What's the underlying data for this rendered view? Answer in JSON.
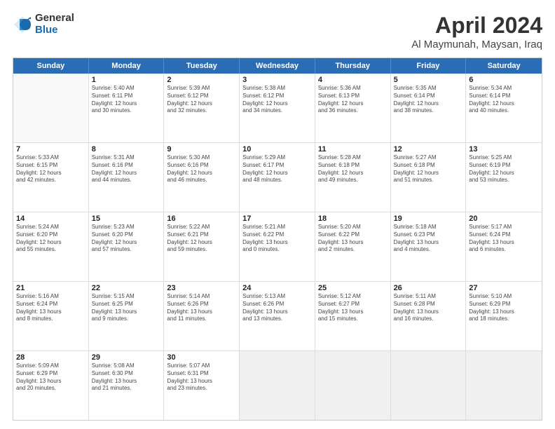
{
  "logo": {
    "general": "General",
    "blue": "Blue"
  },
  "title": {
    "month": "April 2024",
    "location": "Al Maymunah, Maysan, Iraq"
  },
  "days": [
    "Sunday",
    "Monday",
    "Tuesday",
    "Wednesday",
    "Thursday",
    "Friday",
    "Saturday"
  ],
  "weeks": [
    [
      {
        "day": "",
        "data": ""
      },
      {
        "day": "1",
        "data": "Sunrise: 5:40 AM\nSunset: 6:11 PM\nDaylight: 12 hours\nand 30 minutes."
      },
      {
        "day": "2",
        "data": "Sunrise: 5:39 AM\nSunset: 6:12 PM\nDaylight: 12 hours\nand 32 minutes."
      },
      {
        "day": "3",
        "data": "Sunrise: 5:38 AM\nSunset: 6:12 PM\nDaylight: 12 hours\nand 34 minutes."
      },
      {
        "day": "4",
        "data": "Sunrise: 5:36 AM\nSunset: 6:13 PM\nDaylight: 12 hours\nand 36 minutes."
      },
      {
        "day": "5",
        "data": "Sunrise: 5:35 AM\nSunset: 6:14 PM\nDaylight: 12 hours\nand 38 minutes."
      },
      {
        "day": "6",
        "data": "Sunrise: 5:34 AM\nSunset: 6:14 PM\nDaylight: 12 hours\nand 40 minutes."
      }
    ],
    [
      {
        "day": "7",
        "data": "Sunrise: 5:33 AM\nSunset: 6:15 PM\nDaylight: 12 hours\nand 42 minutes."
      },
      {
        "day": "8",
        "data": "Sunrise: 5:31 AM\nSunset: 6:16 PM\nDaylight: 12 hours\nand 44 minutes."
      },
      {
        "day": "9",
        "data": "Sunrise: 5:30 AM\nSunset: 6:16 PM\nDaylight: 12 hours\nand 46 minutes."
      },
      {
        "day": "10",
        "data": "Sunrise: 5:29 AM\nSunset: 6:17 PM\nDaylight: 12 hours\nand 48 minutes."
      },
      {
        "day": "11",
        "data": "Sunrise: 5:28 AM\nSunset: 6:18 PM\nDaylight: 12 hours\nand 49 minutes."
      },
      {
        "day": "12",
        "data": "Sunrise: 5:27 AM\nSunset: 6:18 PM\nDaylight: 12 hours\nand 51 minutes."
      },
      {
        "day": "13",
        "data": "Sunrise: 5:25 AM\nSunset: 6:19 PM\nDaylight: 12 hours\nand 53 minutes."
      }
    ],
    [
      {
        "day": "14",
        "data": "Sunrise: 5:24 AM\nSunset: 6:20 PM\nDaylight: 12 hours\nand 55 minutes."
      },
      {
        "day": "15",
        "data": "Sunrise: 5:23 AM\nSunset: 6:20 PM\nDaylight: 12 hours\nand 57 minutes."
      },
      {
        "day": "16",
        "data": "Sunrise: 5:22 AM\nSunset: 6:21 PM\nDaylight: 12 hours\nand 59 minutes."
      },
      {
        "day": "17",
        "data": "Sunrise: 5:21 AM\nSunset: 6:22 PM\nDaylight: 13 hours\nand 0 minutes."
      },
      {
        "day": "18",
        "data": "Sunrise: 5:20 AM\nSunset: 6:22 PM\nDaylight: 13 hours\nand 2 minutes."
      },
      {
        "day": "19",
        "data": "Sunrise: 5:18 AM\nSunset: 6:23 PM\nDaylight: 13 hours\nand 4 minutes."
      },
      {
        "day": "20",
        "data": "Sunrise: 5:17 AM\nSunset: 6:24 PM\nDaylight: 13 hours\nand 6 minutes."
      }
    ],
    [
      {
        "day": "21",
        "data": "Sunrise: 5:16 AM\nSunset: 6:24 PM\nDaylight: 13 hours\nand 8 minutes."
      },
      {
        "day": "22",
        "data": "Sunrise: 5:15 AM\nSunset: 6:25 PM\nDaylight: 13 hours\nand 9 minutes."
      },
      {
        "day": "23",
        "data": "Sunrise: 5:14 AM\nSunset: 6:26 PM\nDaylight: 13 hours\nand 11 minutes."
      },
      {
        "day": "24",
        "data": "Sunrise: 5:13 AM\nSunset: 6:26 PM\nDaylight: 13 hours\nand 13 minutes."
      },
      {
        "day": "25",
        "data": "Sunrise: 5:12 AM\nSunset: 6:27 PM\nDaylight: 13 hours\nand 15 minutes."
      },
      {
        "day": "26",
        "data": "Sunrise: 5:11 AM\nSunset: 6:28 PM\nDaylight: 13 hours\nand 16 minutes."
      },
      {
        "day": "27",
        "data": "Sunrise: 5:10 AM\nSunset: 6:29 PM\nDaylight: 13 hours\nand 18 minutes."
      }
    ],
    [
      {
        "day": "28",
        "data": "Sunrise: 5:09 AM\nSunset: 6:29 PM\nDaylight: 13 hours\nand 20 minutes."
      },
      {
        "day": "29",
        "data": "Sunrise: 5:08 AM\nSunset: 6:30 PM\nDaylight: 13 hours\nand 21 minutes."
      },
      {
        "day": "30",
        "data": "Sunrise: 5:07 AM\nSunset: 6:31 PM\nDaylight: 13 hours\nand 23 minutes."
      },
      {
        "day": "",
        "data": ""
      },
      {
        "day": "",
        "data": ""
      },
      {
        "day": "",
        "data": ""
      },
      {
        "day": "",
        "data": ""
      }
    ]
  ]
}
